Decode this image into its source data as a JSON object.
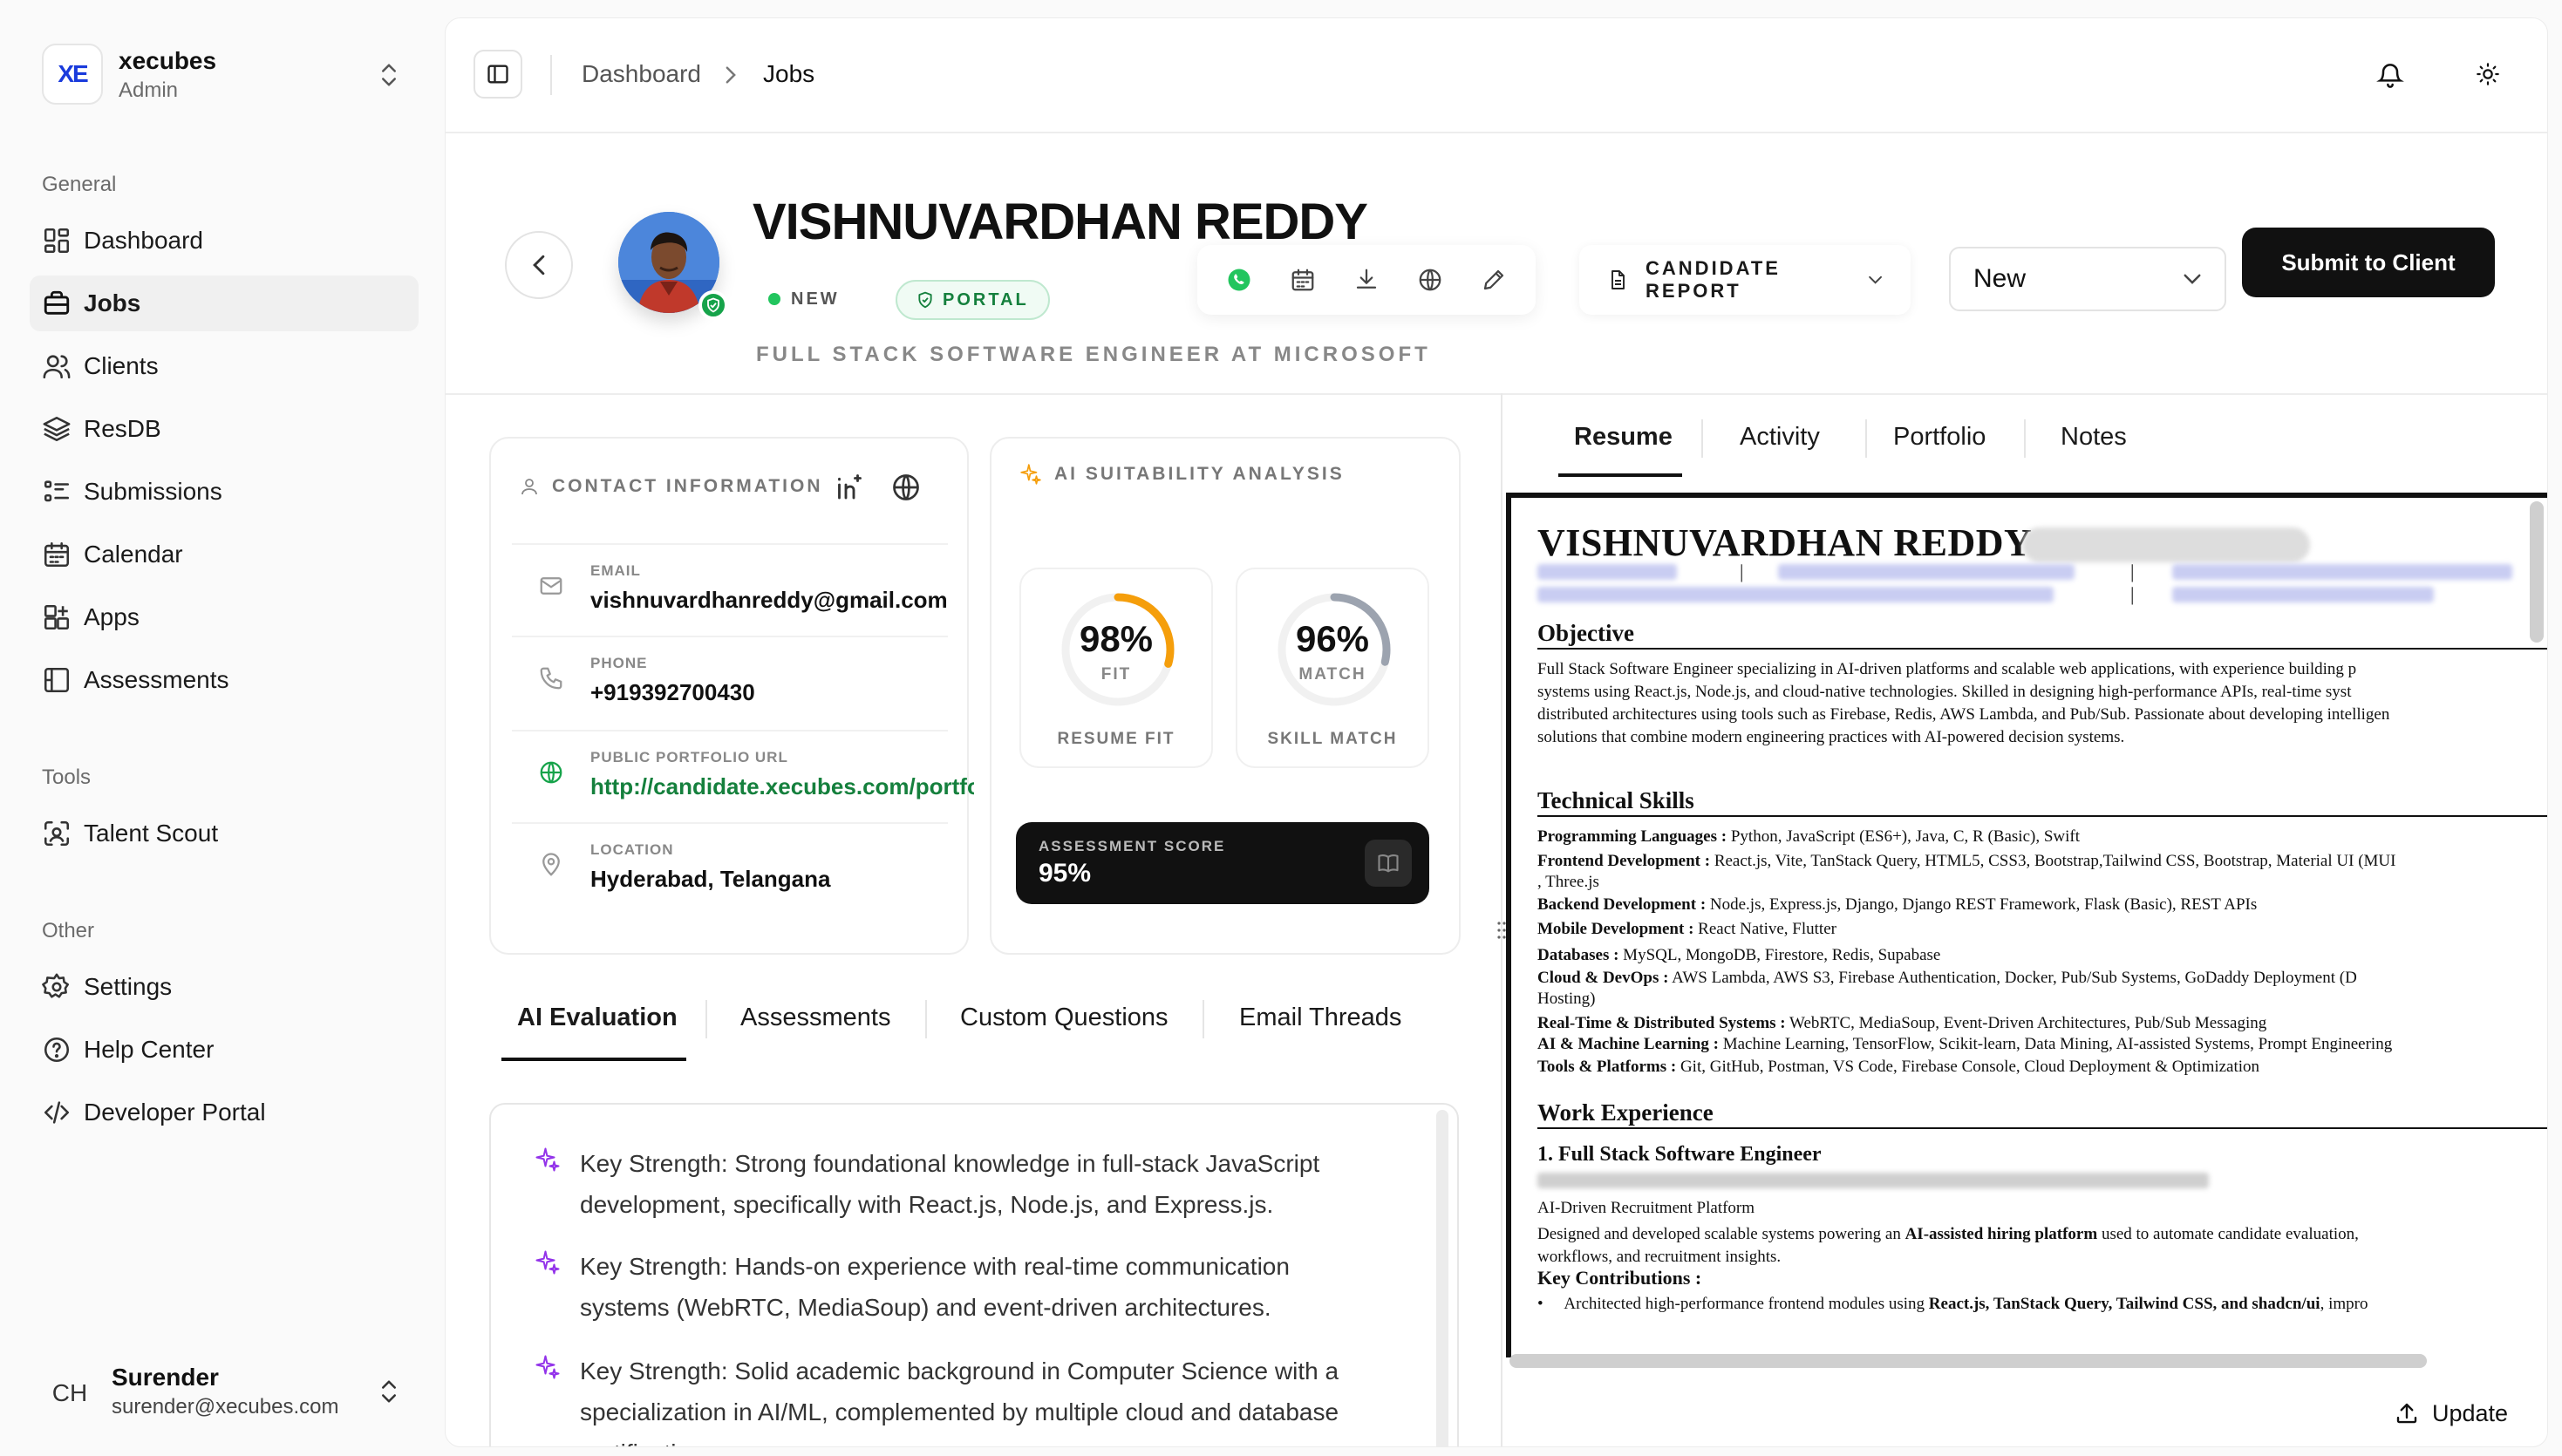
{
  "brand": {
    "name": "xecubes",
    "role": "Admin",
    "logo": "XE"
  },
  "sidebar": {
    "general_title": "General",
    "general": [
      {
        "label": "Dashboard",
        "icon": "grid-icon"
      },
      {
        "label": "Jobs",
        "icon": "briefcase-icon",
        "active": true
      },
      {
        "label": "Clients",
        "icon": "users-icon"
      },
      {
        "label": "ResDB",
        "icon": "layers-icon"
      },
      {
        "label": "Submissions",
        "icon": "list-icon"
      },
      {
        "label": "Calendar",
        "icon": "calendar-icon"
      },
      {
        "label": "Apps",
        "icon": "apps-icon"
      },
      {
        "label": "Assessments",
        "icon": "assessment-icon"
      }
    ],
    "tools_title": "Tools",
    "tools": [
      {
        "label": "Talent Scout",
        "icon": "scan-icon"
      }
    ],
    "other_title": "Other",
    "other": [
      {
        "label": "Settings",
        "icon": "gear-icon"
      },
      {
        "label": "Help Center",
        "icon": "help-icon"
      },
      {
        "label": "Developer Portal",
        "icon": "code-icon"
      }
    ]
  },
  "user": {
    "initials": "CH",
    "name": "Surender",
    "email": "surender@xecubes.com"
  },
  "breadcrumb": {
    "root": "Dashboard",
    "current": "Jobs"
  },
  "candidate": {
    "name": "VISHNUVARDHAN REDDY",
    "status_tag": "NEW",
    "source_tag": "PORTAL",
    "role": "FULL STACK SOFTWARE ENGINEER AT MICROSOFT"
  },
  "header_actions": {
    "report_label": "CANDIDATE REPORT",
    "status_value": "New",
    "submit_label": "Submit to Client"
  },
  "contact": {
    "title": "CONTACT INFORMATION",
    "email_label": "EMAIL",
    "email": "vishnuvardhanreddy@gmail.com",
    "phone_label": "PHONE",
    "phone": "+919392700430",
    "portfolio_label": "PUBLIC PORTFOLIO URL",
    "portfolio": "http://candidate.xecubes.com/portfolio",
    "location_label": "LOCATION",
    "location": "Hyderabad, Telangana"
  },
  "ai": {
    "title": "AI SUITABILITY ANALYSIS",
    "fit_value": "98%",
    "fit_fraction": 0.98,
    "fit_sub": "FIT",
    "fit_label": "RESUME FIT",
    "match_value": "96%",
    "match_fraction": 0.96,
    "match_sub": "MATCH",
    "match_label": "SKILL MATCH",
    "assessment_label": "ASSESSMENT SCORE",
    "assessment_value": "95%",
    "colors": {
      "fit": "#f59e0b",
      "match": "#9ca3af"
    }
  },
  "left_tabs": [
    "AI Evaluation",
    "Assessments",
    "Custom Questions",
    "Email Threads"
  ],
  "evaluation": [
    "Key Strength: Strong foundational knowledge in full-stack JavaScript development, specifically with React.js, Node.js, and Express.js.",
    "Key Strength: Hands-on experience with real-time communication systems (WebRTC, MediaSoup) and event-driven architectures.",
    "Key Strength: Solid academic background in Computer Science with a specialization in AI/ML, complemented by multiple cloud and database certifications."
  ],
  "right_tabs": [
    "Resume",
    "Activity",
    "Portfolio",
    "Notes"
  ],
  "resume": {
    "name": "VISHNUVARDHAN REDDY",
    "objective_title": "Objective",
    "objective": [
      "Full Stack Software Engineer specializing in AI-driven platforms and scalable web applications, with experience building p",
      "systems using React.js, Node.js, and cloud-native technologies. Skilled in designing high-performance APIs, real-time syst",
      "distributed architectures using tools such as Firebase, Redis, AWS Lambda, and Pub/Sub. Passionate about developing intelligen",
      "solutions that combine modern engineering practices with AI-powered decision systems."
    ],
    "skills_title": "Technical Skills",
    "skills": [
      {
        "k": "Programming Languages :",
        "v": " Python, JavaScript (ES6+), Java, C, R (Basic), Swift"
      },
      {
        "k": "Frontend Development :",
        "v": " React.js, Vite, TanStack Query, HTML5, CSS3, Bootstrap,Tailwind CSS, Bootstrap, Material UI (MUI"
      },
      {
        "k": "",
        "v": ", Three.js"
      },
      {
        "k": "Backend Development :",
        "v": " Node.js, Express.js, Django, Django REST Framework, Flask (Basic), REST APIs"
      },
      {
        "k": "Mobile Development :",
        "v": " React Native, Flutter"
      },
      {
        "k": "Databases :",
        "v": " MySQL, MongoDB, Firestore, Redis, Supabase"
      },
      {
        "k": "Cloud & DevOps :",
        "v": " AWS Lambda, AWS S3, Firebase Authentication, Docker, Pub/Sub Systems, GoDaddy Deployment (D"
      },
      {
        "k": "",
        "v": "Hosting)"
      },
      {
        "k": "Real-Time & Distributed Systems :",
        "v": " WebRTC, MediaSoup, Event-Driven Architectures, Pub/Sub Messaging"
      },
      {
        "k": "AI & Machine Learning :",
        "v": " Machine Learning, TensorFlow, Scikit-learn, Data Mining, AI-assisted Systems, Prompt Engineering"
      },
      {
        "k": "Tools & Platforms :",
        "v": " Git, GitHub, Postman, VS Code, Firebase Console, Cloud Deployment & Optimization"
      }
    ],
    "work_title": "Work Experience",
    "job_title": "1. Full Stack Software Engineer",
    "job_platform": "AI-Driven Recruitment Platform",
    "job_desc_1a": "Designed and developed scalable systems powering an ",
    "job_desc_1b": "AI-assisted hiring platform",
    "job_desc_1c": " used to automate candidate evaluation,",
    "job_desc_2": "workflows, and recruitment insights.",
    "contrib_title": "Key Contributions :",
    "contrib_1a": "Architected high-performance frontend modules using ",
    "contrib_1b": "React.js, TanStack Query, Tailwind CSS, and shadcn/ui",
    "contrib_1c": ", impro"
  },
  "update_label": "Update"
}
